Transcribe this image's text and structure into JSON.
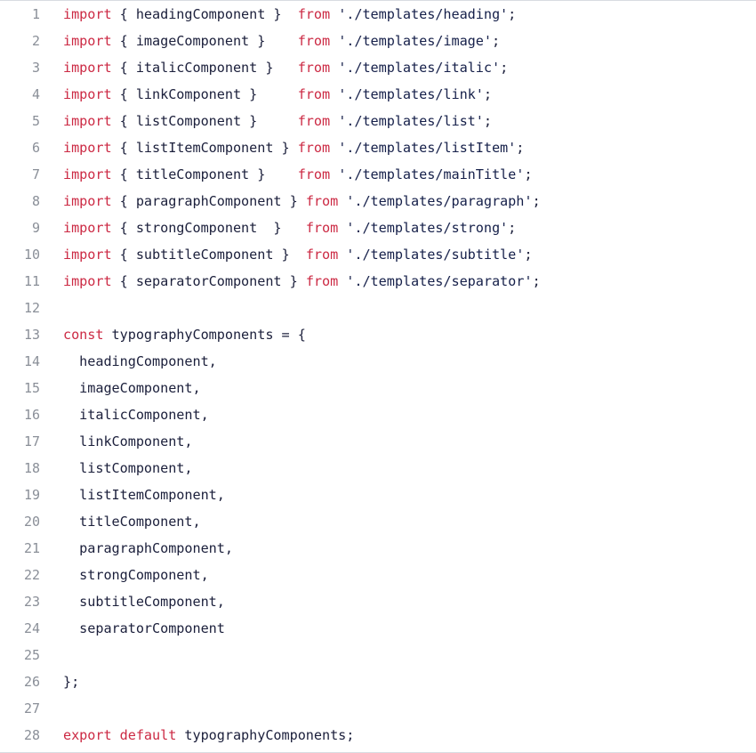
{
  "editor": {
    "language": "javascript",
    "total_lines": 28,
    "colors": {
      "background": "#ffffff",
      "keyword": "#cc2a44",
      "string": "#16204a",
      "identifier": "#1b1f3b",
      "line_number": "#8a8f98",
      "border": "#d8dce1"
    }
  },
  "lines": [
    {
      "number": "1",
      "tokens": [
        {
          "t": "keyword",
          "v": "import"
        },
        {
          "t": "plain",
          "v": " { headingComponent }  "
        },
        {
          "t": "keyword",
          "v": "from"
        },
        {
          "t": "plain",
          "v": " "
        },
        {
          "t": "string",
          "v": "'./templates/heading'"
        },
        {
          "t": "punct",
          "v": ";"
        }
      ]
    },
    {
      "number": "2",
      "tokens": [
        {
          "t": "keyword",
          "v": "import"
        },
        {
          "t": "plain",
          "v": " { imageComponent }    "
        },
        {
          "t": "keyword",
          "v": "from"
        },
        {
          "t": "plain",
          "v": " "
        },
        {
          "t": "string",
          "v": "'./templates/image'"
        },
        {
          "t": "punct",
          "v": ";"
        }
      ]
    },
    {
      "number": "3",
      "tokens": [
        {
          "t": "keyword",
          "v": "import"
        },
        {
          "t": "plain",
          "v": " { italicComponent }   "
        },
        {
          "t": "keyword",
          "v": "from"
        },
        {
          "t": "plain",
          "v": " "
        },
        {
          "t": "string",
          "v": "'./templates/italic'"
        },
        {
          "t": "punct",
          "v": ";"
        }
      ]
    },
    {
      "number": "4",
      "tokens": [
        {
          "t": "keyword",
          "v": "import"
        },
        {
          "t": "plain",
          "v": " { linkComponent }     "
        },
        {
          "t": "keyword",
          "v": "from"
        },
        {
          "t": "plain",
          "v": " "
        },
        {
          "t": "string",
          "v": "'./templates/link'"
        },
        {
          "t": "punct",
          "v": ";"
        }
      ]
    },
    {
      "number": "5",
      "tokens": [
        {
          "t": "keyword",
          "v": "import"
        },
        {
          "t": "plain",
          "v": " { listComponent }     "
        },
        {
          "t": "keyword",
          "v": "from"
        },
        {
          "t": "plain",
          "v": " "
        },
        {
          "t": "string",
          "v": "'./templates/list'"
        },
        {
          "t": "punct",
          "v": ";"
        }
      ]
    },
    {
      "number": "6",
      "tokens": [
        {
          "t": "keyword",
          "v": "import"
        },
        {
          "t": "plain",
          "v": " { listItemComponent } "
        },
        {
          "t": "keyword",
          "v": "from"
        },
        {
          "t": "plain",
          "v": " "
        },
        {
          "t": "string",
          "v": "'./templates/listItem'"
        },
        {
          "t": "punct",
          "v": ";"
        }
      ]
    },
    {
      "number": "7",
      "tokens": [
        {
          "t": "keyword",
          "v": "import"
        },
        {
          "t": "plain",
          "v": " { titleComponent }    "
        },
        {
          "t": "keyword",
          "v": "from"
        },
        {
          "t": "plain",
          "v": " "
        },
        {
          "t": "string",
          "v": "'./templates/mainTitle'"
        },
        {
          "t": "punct",
          "v": ";"
        }
      ]
    },
    {
      "number": "8",
      "tokens": [
        {
          "t": "keyword",
          "v": "import"
        },
        {
          "t": "plain",
          "v": " { paragraphComponent } "
        },
        {
          "t": "keyword",
          "v": "from"
        },
        {
          "t": "plain",
          "v": " "
        },
        {
          "t": "string",
          "v": "'./templates/paragraph'"
        },
        {
          "t": "punct",
          "v": ";"
        }
      ]
    },
    {
      "number": "9",
      "tokens": [
        {
          "t": "keyword",
          "v": "import"
        },
        {
          "t": "plain",
          "v": " { strongComponent  }   "
        },
        {
          "t": "keyword",
          "v": "from"
        },
        {
          "t": "plain",
          "v": " "
        },
        {
          "t": "string",
          "v": "'./templates/strong'"
        },
        {
          "t": "punct",
          "v": ";"
        }
      ]
    },
    {
      "number": "10",
      "tokens": [
        {
          "t": "keyword",
          "v": "import"
        },
        {
          "t": "plain",
          "v": " { subtitleComponent }  "
        },
        {
          "t": "keyword",
          "v": "from"
        },
        {
          "t": "plain",
          "v": " "
        },
        {
          "t": "string",
          "v": "'./templates/subtitle'"
        },
        {
          "t": "punct",
          "v": ";"
        }
      ]
    },
    {
      "number": "11",
      "tokens": [
        {
          "t": "keyword",
          "v": "import"
        },
        {
          "t": "plain",
          "v": " { separatorComponent } "
        },
        {
          "t": "keyword",
          "v": "from"
        },
        {
          "t": "plain",
          "v": " "
        },
        {
          "t": "string",
          "v": "'./templates/separator'"
        },
        {
          "t": "punct",
          "v": ";"
        }
      ]
    },
    {
      "number": "12",
      "tokens": []
    },
    {
      "number": "13",
      "tokens": [
        {
          "t": "keyword",
          "v": "const"
        },
        {
          "t": "plain",
          "v": " typographyComponents = {"
        }
      ]
    },
    {
      "number": "14",
      "tokens": [
        {
          "t": "plain",
          "v": "  headingComponent,"
        }
      ]
    },
    {
      "number": "15",
      "tokens": [
        {
          "t": "plain",
          "v": "  imageComponent,"
        }
      ]
    },
    {
      "number": "16",
      "tokens": [
        {
          "t": "plain",
          "v": "  italicComponent,"
        }
      ]
    },
    {
      "number": "17",
      "tokens": [
        {
          "t": "plain",
          "v": "  linkComponent,"
        }
      ]
    },
    {
      "number": "18",
      "tokens": [
        {
          "t": "plain",
          "v": "  listComponent,"
        }
      ]
    },
    {
      "number": "19",
      "tokens": [
        {
          "t": "plain",
          "v": "  listItemComponent,"
        }
      ]
    },
    {
      "number": "20",
      "tokens": [
        {
          "t": "plain",
          "v": "  titleComponent,"
        }
      ]
    },
    {
      "number": "21",
      "tokens": [
        {
          "t": "plain",
          "v": "  paragraphComponent,"
        }
      ]
    },
    {
      "number": "22",
      "tokens": [
        {
          "t": "plain",
          "v": "  strongComponent,"
        }
      ]
    },
    {
      "number": "23",
      "tokens": [
        {
          "t": "plain",
          "v": "  subtitleComponent,"
        }
      ]
    },
    {
      "number": "24",
      "tokens": [
        {
          "t": "plain",
          "v": "  separatorComponent"
        }
      ]
    },
    {
      "number": "25",
      "tokens": []
    },
    {
      "number": "26",
      "tokens": [
        {
          "t": "plain",
          "v": "};"
        }
      ]
    },
    {
      "number": "27",
      "tokens": []
    },
    {
      "number": "28",
      "tokens": [
        {
          "t": "keyword",
          "v": "export"
        },
        {
          "t": "plain",
          "v": " "
        },
        {
          "t": "keyword",
          "v": "default"
        },
        {
          "t": "plain",
          "v": " typographyComponents;"
        }
      ]
    }
  ]
}
